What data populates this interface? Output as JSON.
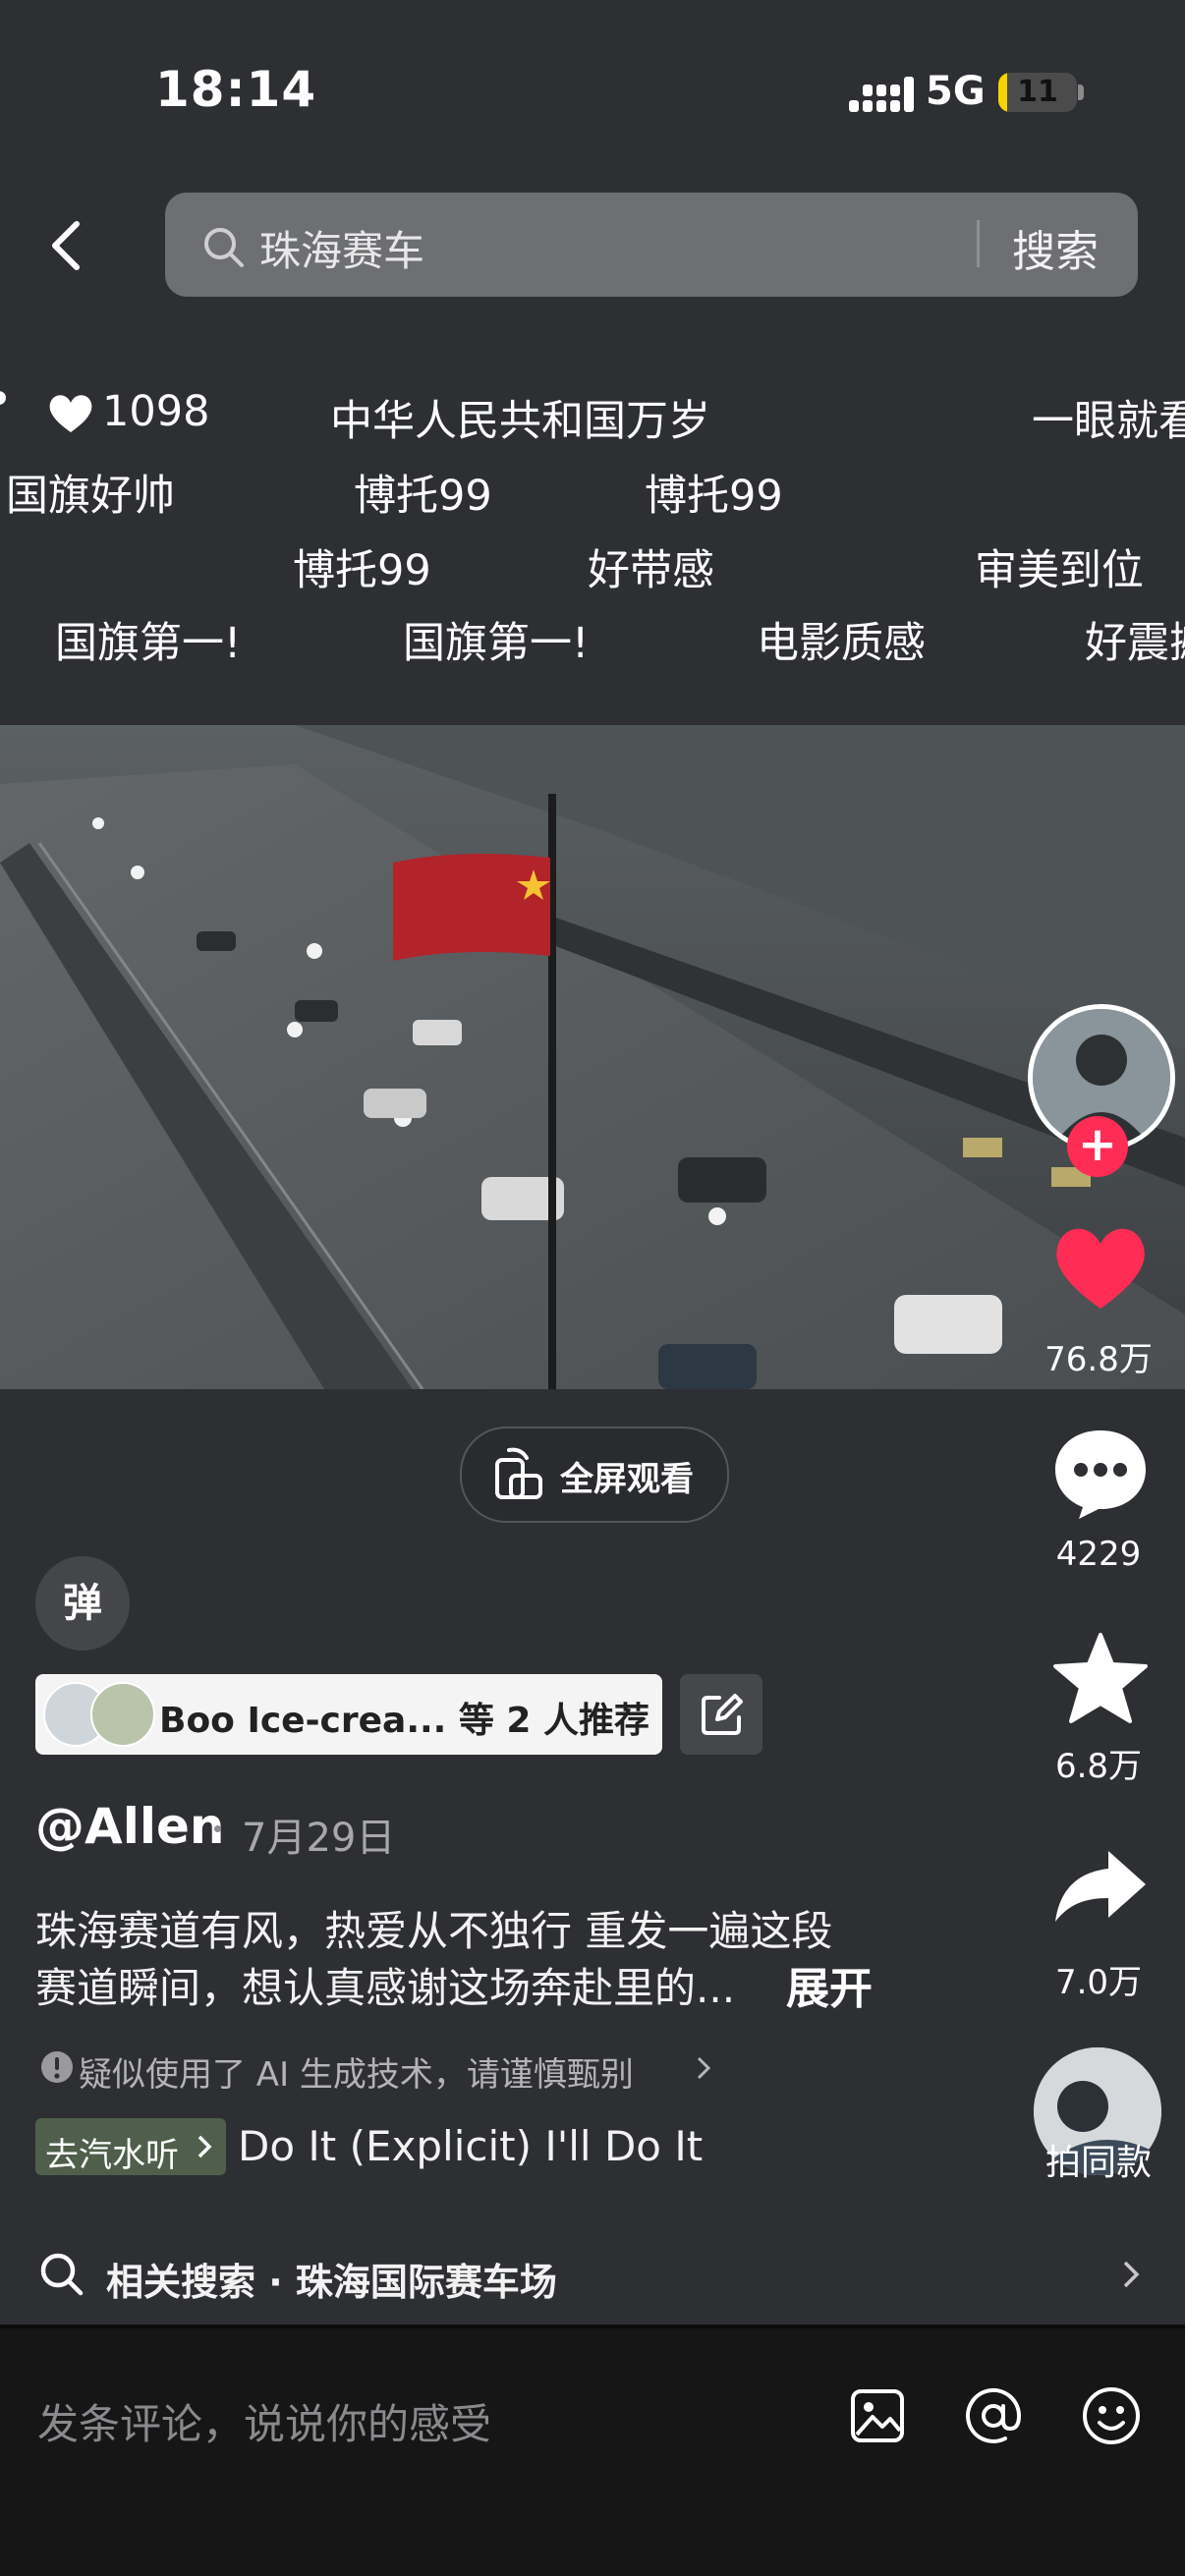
{
  "status_bar": {
    "time": "18:14",
    "network": "5G",
    "battery": "11",
    "battery_level": 0.11
  },
  "search": {
    "query": "珠海赛车",
    "button": "搜索"
  },
  "danmu": {
    "row1": {
      "likes": "1098",
      "items": [
        "中华人民共和国万岁",
        "一眼就看"
      ]
    },
    "row2": [
      "国旗好帅",
      "博托99",
      "博托99"
    ],
    "row3": [
      "博托99",
      "好带感",
      "审美到位"
    ],
    "row4": [
      "国旗第一!",
      "国旗第一!",
      "电影质感",
      "好震撼"
    ]
  },
  "side": {
    "likes": "76.8万",
    "comments": "4229",
    "favorites": "6.8万",
    "shares": "7.0万",
    "same_style": "拍同款"
  },
  "fullscreen": "全屏观看",
  "danmu_toggle": "弹",
  "recommend": {
    "text": "Boo Ice-crea...  等 2 人推荐"
  },
  "post": {
    "author": "@Allen",
    "date": "7月29日",
    "desc_line1": "珠海赛道有风，热爱从不独行 重发一遍这段",
    "desc_line2": "赛道瞬间，想认真感谢这场奔赴里的...",
    "expand": "展开",
    "ai_note": "疑似使用了 AI 生成技术，请谨慎甄别",
    "music_tag": "去汽水听",
    "music": "Do It (Explicit)  I'll Do It"
  },
  "related": {
    "label": "相关搜索 · 珠海国际赛车场"
  },
  "comment": {
    "placeholder": "发条评论，说说你的感受"
  }
}
